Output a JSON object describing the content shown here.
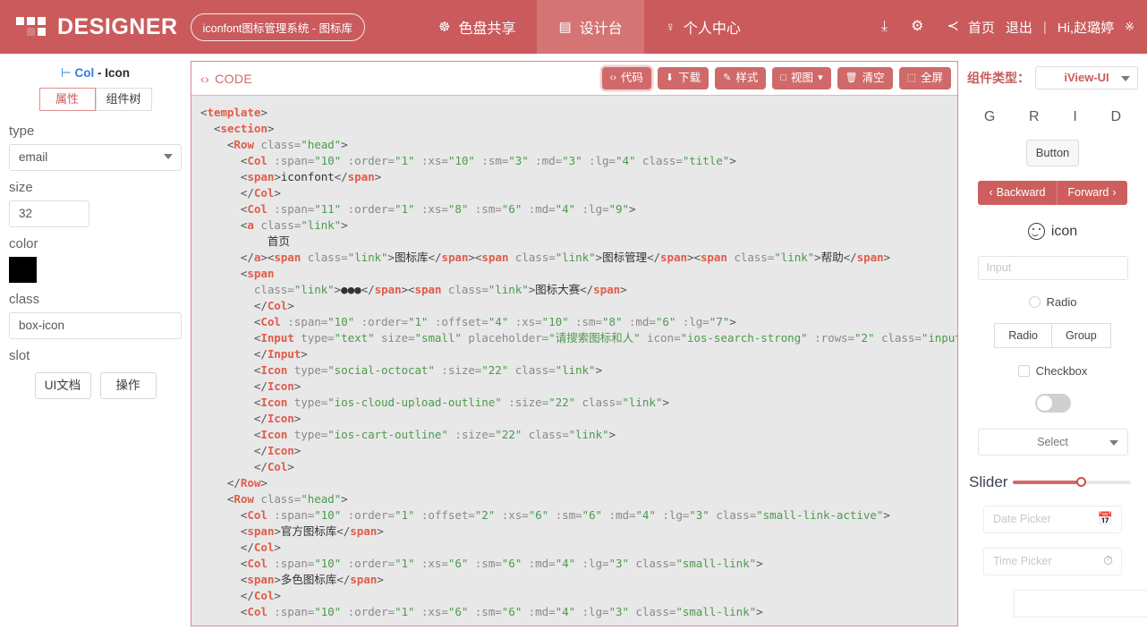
{
  "header": {
    "brand": "DESIGNER",
    "system_chip": "iconfont图标管理系统 - 图标库",
    "nav": [
      {
        "icon": "palette-icon",
        "glyph": "☸",
        "label": "色盘共享",
        "active": false
      },
      {
        "icon": "easel-icon",
        "glyph": "▤",
        "label": "设计台",
        "active": true
      },
      {
        "icon": "user-icon",
        "glyph": "♀",
        "label": "个人中心",
        "active": false
      }
    ],
    "tools": [
      {
        "name": "upload-icon",
        "glyph": "⤓"
      },
      {
        "name": "gear-icon",
        "glyph": "⚙"
      },
      {
        "name": "share-icon",
        "glyph": "≺"
      }
    ],
    "home_label": "首页",
    "logout_label": "退出",
    "divider": "|",
    "greeting": "Hi,赵璐婷",
    "sun_glyph": "※"
  },
  "sidebar": {
    "title_tick": "⊢",
    "title_component": "Col",
    "title_suffix": "- Icon",
    "tabs": [
      {
        "label": "属性",
        "selected": true
      },
      {
        "label": "组件树",
        "selected": false
      }
    ],
    "fields": [
      {
        "label": "type",
        "kind": "select",
        "value": "email"
      },
      {
        "label": "size",
        "kind": "text",
        "value": "32"
      },
      {
        "label": "color",
        "kind": "color",
        "value": "#000000"
      },
      {
        "label": "class",
        "kind": "text",
        "value": "box-icon"
      },
      {
        "label": "slot",
        "kind": "buttons"
      }
    ],
    "slot_buttons": [
      {
        "label": "UI文档"
      },
      {
        "label": "操作"
      }
    ]
  },
  "code_panel": {
    "title": "CODE",
    "title_glyph": "‹›",
    "buttons": [
      {
        "glyph": "‹›",
        "label": "代码",
        "highlight": true,
        "caret": false
      },
      {
        "glyph": "⬇",
        "label": "下载",
        "highlight": false,
        "caret": false
      },
      {
        "glyph": "✎",
        "label": "样式",
        "highlight": false,
        "caret": false
      },
      {
        "glyph": "□",
        "label": "视图",
        "highlight": false,
        "caret": true
      },
      {
        "glyph": "🗑",
        "label": "清空",
        "highlight": false,
        "caret": false
      },
      {
        "glyph": "⬚",
        "label": "全屏",
        "highlight": false,
        "caret": false
      }
    ],
    "code_lines": [
      [
        [
          "pt",
          "<"
        ],
        [
          "tg",
          "template"
        ],
        [
          "pt",
          ">"
        ]
      ],
      [
        [
          "pt",
          "  <"
        ],
        [
          "tg",
          "section"
        ],
        [
          "pt",
          ">"
        ]
      ],
      [
        [
          "pt",
          "    <"
        ],
        [
          "tg",
          "Row"
        ],
        [
          "at",
          " class="
        ],
        [
          "vl",
          "\"head\""
        ],
        [
          "pt",
          ">"
        ]
      ],
      [
        [
          "pt",
          "      <"
        ],
        [
          "tg",
          "Col"
        ],
        [
          "at",
          " :span="
        ],
        [
          "vl",
          "\"10\""
        ],
        [
          "at",
          " :order="
        ],
        [
          "vl",
          "\"1\""
        ],
        [
          "at",
          " :xs="
        ],
        [
          "vl",
          "\"10\""
        ],
        [
          "at",
          " :sm="
        ],
        [
          "vl",
          "\"3\""
        ],
        [
          "at",
          " :md="
        ],
        [
          "vl",
          "\"3\""
        ],
        [
          "at",
          " :lg="
        ],
        [
          "vl",
          "\"4\""
        ],
        [
          "at",
          " class="
        ],
        [
          "vl",
          "\"title\""
        ],
        [
          "pt",
          ">"
        ]
      ],
      [
        [
          "pt",
          "      <"
        ],
        [
          "tg",
          "span"
        ],
        [
          "pt",
          ">"
        ],
        [
          "tx",
          "iconfont"
        ],
        [
          "pt",
          "</"
        ],
        [
          "tg",
          "span"
        ],
        [
          "pt",
          ">"
        ]
      ],
      [
        [
          "pt",
          "      </"
        ],
        [
          "tg",
          "Col"
        ],
        [
          "pt",
          ">"
        ]
      ],
      [
        [
          "pt",
          "      <"
        ],
        [
          "tg",
          "Col"
        ],
        [
          "at",
          " :span="
        ],
        [
          "vl",
          "\"11\""
        ],
        [
          "at",
          " :order="
        ],
        [
          "vl",
          "\"1\""
        ],
        [
          "at",
          " :xs="
        ],
        [
          "vl",
          "\"8\""
        ],
        [
          "at",
          " :sm="
        ],
        [
          "vl",
          "\"6\""
        ],
        [
          "at",
          " :md="
        ],
        [
          "vl",
          "\"4\""
        ],
        [
          "at",
          " :lg="
        ],
        [
          "vl",
          "\"9\""
        ],
        [
          "pt",
          ">"
        ]
      ],
      [
        [
          "pt",
          "      <"
        ],
        [
          "tg",
          "a"
        ],
        [
          "at",
          " class="
        ],
        [
          "vl",
          "\"link\""
        ],
        [
          "pt",
          ">"
        ]
      ],
      [
        [
          "tx",
          "          首页"
        ]
      ],
      [
        [
          "pt",
          "      </"
        ],
        [
          "tg",
          "a"
        ],
        [
          "pt",
          "><"
        ],
        [
          "tg",
          "span"
        ],
        [
          "at",
          " class="
        ],
        [
          "vl",
          "\"link\""
        ],
        [
          "pt",
          ">"
        ],
        [
          "tx",
          "图标库"
        ],
        [
          "pt",
          "</"
        ],
        [
          "tg",
          "span"
        ],
        [
          "pt",
          "><"
        ],
        [
          "tg",
          "span"
        ],
        [
          "at",
          " class="
        ],
        [
          "vl",
          "\"link\""
        ],
        [
          "pt",
          ">"
        ],
        [
          "tx",
          "图标管理"
        ],
        [
          "pt",
          "</"
        ],
        [
          "tg",
          "span"
        ],
        [
          "pt",
          "><"
        ],
        [
          "tg",
          "span"
        ],
        [
          "at",
          " class="
        ],
        [
          "vl",
          "\"link\""
        ],
        [
          "pt",
          ">"
        ],
        [
          "tx",
          "帮助"
        ],
        [
          "pt",
          "</"
        ],
        [
          "tg",
          "span"
        ],
        [
          "pt",
          ">"
        ]
      ],
      [
        [
          "pt",
          "      <"
        ],
        [
          "tg",
          "span"
        ]
      ],
      [
        [
          "at",
          "        class="
        ],
        [
          "vl",
          "\"link\""
        ],
        [
          "pt",
          ">"
        ],
        [
          "tx",
          "●●●"
        ],
        [
          "pt",
          "</"
        ],
        [
          "tg",
          "span"
        ],
        [
          "pt",
          "><"
        ],
        [
          "tg",
          "span"
        ],
        [
          "at",
          " class="
        ],
        [
          "vl",
          "\"link\""
        ],
        [
          "pt",
          ">"
        ],
        [
          "tx",
          "图标大赛"
        ],
        [
          "pt",
          "</"
        ],
        [
          "tg",
          "span"
        ],
        [
          "pt",
          ">"
        ]
      ],
      [
        [
          "pt",
          "        </"
        ],
        [
          "tg",
          "Col"
        ],
        [
          "pt",
          ">"
        ]
      ],
      [
        [
          "pt",
          "        <"
        ],
        [
          "tg",
          "Col"
        ],
        [
          "at",
          " :span="
        ],
        [
          "vl",
          "\"10\""
        ],
        [
          "at",
          " :order="
        ],
        [
          "vl",
          "\"1\""
        ],
        [
          "at",
          " :offset="
        ],
        [
          "vl",
          "\"4\""
        ],
        [
          "at",
          " :xs="
        ],
        [
          "vl",
          "\"10\""
        ],
        [
          "at",
          " :sm="
        ],
        [
          "vl",
          "\"8\""
        ],
        [
          "at",
          " :md="
        ],
        [
          "vl",
          "\"6\""
        ],
        [
          "at",
          " :lg="
        ],
        [
          "vl",
          "\"7\""
        ],
        [
          "pt",
          ">"
        ]
      ],
      [
        [
          "pt",
          "        <"
        ],
        [
          "tg",
          "Input"
        ],
        [
          "at",
          " type="
        ],
        [
          "vl",
          "\"text\""
        ],
        [
          "at",
          " size="
        ],
        [
          "vl",
          "\"small\""
        ],
        [
          "at",
          " placeholder="
        ],
        [
          "vl",
          "\"请搜索图标和人\""
        ],
        [
          "at",
          " icon="
        ],
        [
          "vl",
          "\"ios-search-strong\""
        ],
        [
          "at",
          " :rows="
        ],
        [
          "vl",
          "\"2\""
        ],
        [
          "at",
          " class="
        ],
        [
          "vl",
          "\"input\""
        ],
        [
          "pt",
          ">"
        ]
      ],
      [
        [
          "pt",
          "        </"
        ],
        [
          "tg",
          "Input"
        ],
        [
          "pt",
          ">"
        ]
      ],
      [
        [
          "pt",
          "        <"
        ],
        [
          "tg",
          "Icon"
        ],
        [
          "at",
          " type="
        ],
        [
          "vl",
          "\"social-octocat\""
        ],
        [
          "at",
          " :size="
        ],
        [
          "vl",
          "\"22\""
        ],
        [
          "at",
          " class="
        ],
        [
          "vl",
          "\"link\""
        ],
        [
          "pt",
          ">"
        ]
      ],
      [
        [
          "pt",
          "        </"
        ],
        [
          "tg",
          "Icon"
        ],
        [
          "pt",
          ">"
        ]
      ],
      [
        [
          "pt",
          "        <"
        ],
        [
          "tg",
          "Icon"
        ],
        [
          "at",
          " type="
        ],
        [
          "vl",
          "\"ios-cloud-upload-outline\""
        ],
        [
          "at",
          " :size="
        ],
        [
          "vl",
          "\"22\""
        ],
        [
          "at",
          " class="
        ],
        [
          "vl",
          "\"link\""
        ],
        [
          "pt",
          ">"
        ]
      ],
      [
        [
          "pt",
          "        </"
        ],
        [
          "tg",
          "Icon"
        ],
        [
          "pt",
          ">"
        ]
      ],
      [
        [
          "pt",
          "        <"
        ],
        [
          "tg",
          "Icon"
        ],
        [
          "at",
          " type="
        ],
        [
          "vl",
          "\"ios-cart-outline\""
        ],
        [
          "at",
          " :size="
        ],
        [
          "vl",
          "\"22\""
        ],
        [
          "at",
          " class="
        ],
        [
          "vl",
          "\"link\""
        ],
        [
          "pt",
          ">"
        ]
      ],
      [
        [
          "pt",
          "        </"
        ],
        [
          "tg",
          "Icon"
        ],
        [
          "pt",
          ">"
        ]
      ],
      [
        [
          "pt",
          "        </"
        ],
        [
          "tg",
          "Col"
        ],
        [
          "pt",
          ">"
        ]
      ],
      [
        [
          "pt",
          "    </"
        ],
        [
          "tg",
          "Row"
        ],
        [
          "pt",
          ">"
        ]
      ],
      [
        [
          "pt",
          "    <"
        ],
        [
          "tg",
          "Row"
        ],
        [
          "at",
          " class="
        ],
        [
          "vl",
          "\"head\""
        ],
        [
          "pt",
          ">"
        ]
      ],
      [
        [
          "pt",
          "      <"
        ],
        [
          "tg",
          "Col"
        ],
        [
          "at",
          " :span="
        ],
        [
          "vl",
          "\"10\""
        ],
        [
          "at",
          " :order="
        ],
        [
          "vl",
          "\"1\""
        ],
        [
          "at",
          " :offset="
        ],
        [
          "vl",
          "\"2\""
        ],
        [
          "at",
          " :xs="
        ],
        [
          "vl",
          "\"6\""
        ],
        [
          "at",
          " :sm="
        ],
        [
          "vl",
          "\"6\""
        ],
        [
          "at",
          " :md="
        ],
        [
          "vl",
          "\"4\""
        ],
        [
          "at",
          " :lg="
        ],
        [
          "vl",
          "\"3\""
        ],
        [
          "at",
          " class="
        ],
        [
          "vl",
          "\"small-link-active\""
        ],
        [
          "pt",
          ">"
        ]
      ],
      [
        [
          "pt",
          "      <"
        ],
        [
          "tg",
          "span"
        ],
        [
          "pt",
          ">"
        ],
        [
          "tx",
          "官方图标库"
        ],
        [
          "pt",
          "</"
        ],
        [
          "tg",
          "span"
        ],
        [
          "pt",
          ">"
        ]
      ],
      [
        [
          "pt",
          "      </"
        ],
        [
          "tg",
          "Col"
        ],
        [
          "pt",
          ">"
        ]
      ],
      [
        [
          "pt",
          "      <"
        ],
        [
          "tg",
          "Col"
        ],
        [
          "at",
          " :span="
        ],
        [
          "vl",
          "\"10\""
        ],
        [
          "at",
          " :order="
        ],
        [
          "vl",
          "\"1\""
        ],
        [
          "at",
          " :xs="
        ],
        [
          "vl",
          "\"6\""
        ],
        [
          "at",
          " :sm="
        ],
        [
          "vl",
          "\"6\""
        ],
        [
          "at",
          " :md="
        ],
        [
          "vl",
          "\"4\""
        ],
        [
          "at",
          " :lg="
        ],
        [
          "vl",
          "\"3\""
        ],
        [
          "at",
          " class="
        ],
        [
          "vl",
          "\"small-link\""
        ],
        [
          "pt",
          ">"
        ]
      ],
      [
        [
          "pt",
          "      <"
        ],
        [
          "tg",
          "span"
        ],
        [
          "pt",
          ">"
        ],
        [
          "tx",
          "多色图标库"
        ],
        [
          "pt",
          "</"
        ],
        [
          "tg",
          "span"
        ],
        [
          "pt",
          ">"
        ]
      ],
      [
        [
          "pt",
          "      </"
        ],
        [
          "tg",
          "Col"
        ],
        [
          "pt",
          ">"
        ]
      ],
      [
        [
          "pt",
          "      <"
        ],
        [
          "tg",
          "Col"
        ],
        [
          "at",
          " :span="
        ],
        [
          "vl",
          "\"10\""
        ],
        [
          "at",
          " :order="
        ],
        [
          "vl",
          "\"1\""
        ],
        [
          "at",
          " :xs="
        ],
        [
          "vl",
          "\"6\""
        ],
        [
          "at",
          " :sm="
        ],
        [
          "vl",
          "\"6\""
        ],
        [
          "at",
          " :md="
        ],
        [
          "vl",
          "\"4\""
        ],
        [
          "at",
          " :lg="
        ],
        [
          "vl",
          "\"3\""
        ],
        [
          "at",
          " class="
        ],
        [
          "vl",
          "\"small-link\""
        ],
        [
          "pt",
          ">"
        ]
      ]
    ]
  },
  "right_panel": {
    "component_type_label": "组件类型：",
    "component_type_value": "iView-UI",
    "grid_letters": [
      "G",
      "R",
      "I",
      "D"
    ],
    "button_label": "Button",
    "backward_label": "Backward",
    "forward_label": "Forward",
    "backward_glyph": "‹",
    "forward_glyph": "›",
    "icon_label": "icon",
    "input_placeholder": "Input",
    "radio_label": "Radio",
    "radio_group": [
      "Radio",
      "Group"
    ],
    "checkbox_label": "Checkbox",
    "select_label": "Select",
    "slider_label": "Slider",
    "slider_value": 57,
    "date_picker_placeholder": "Date Picker",
    "time_picker_placeholder": "Time Picker",
    "date_glyph": "Ὄ5",
    "time_glyph": "◴"
  },
  "colors": {
    "header_red": "#ca5a5c",
    "active_tab": "#d57475",
    "button_red": "#d06a6a",
    "accent_blue": "#2f7fe0",
    "code_bg": "#e8e8e8"
  }
}
